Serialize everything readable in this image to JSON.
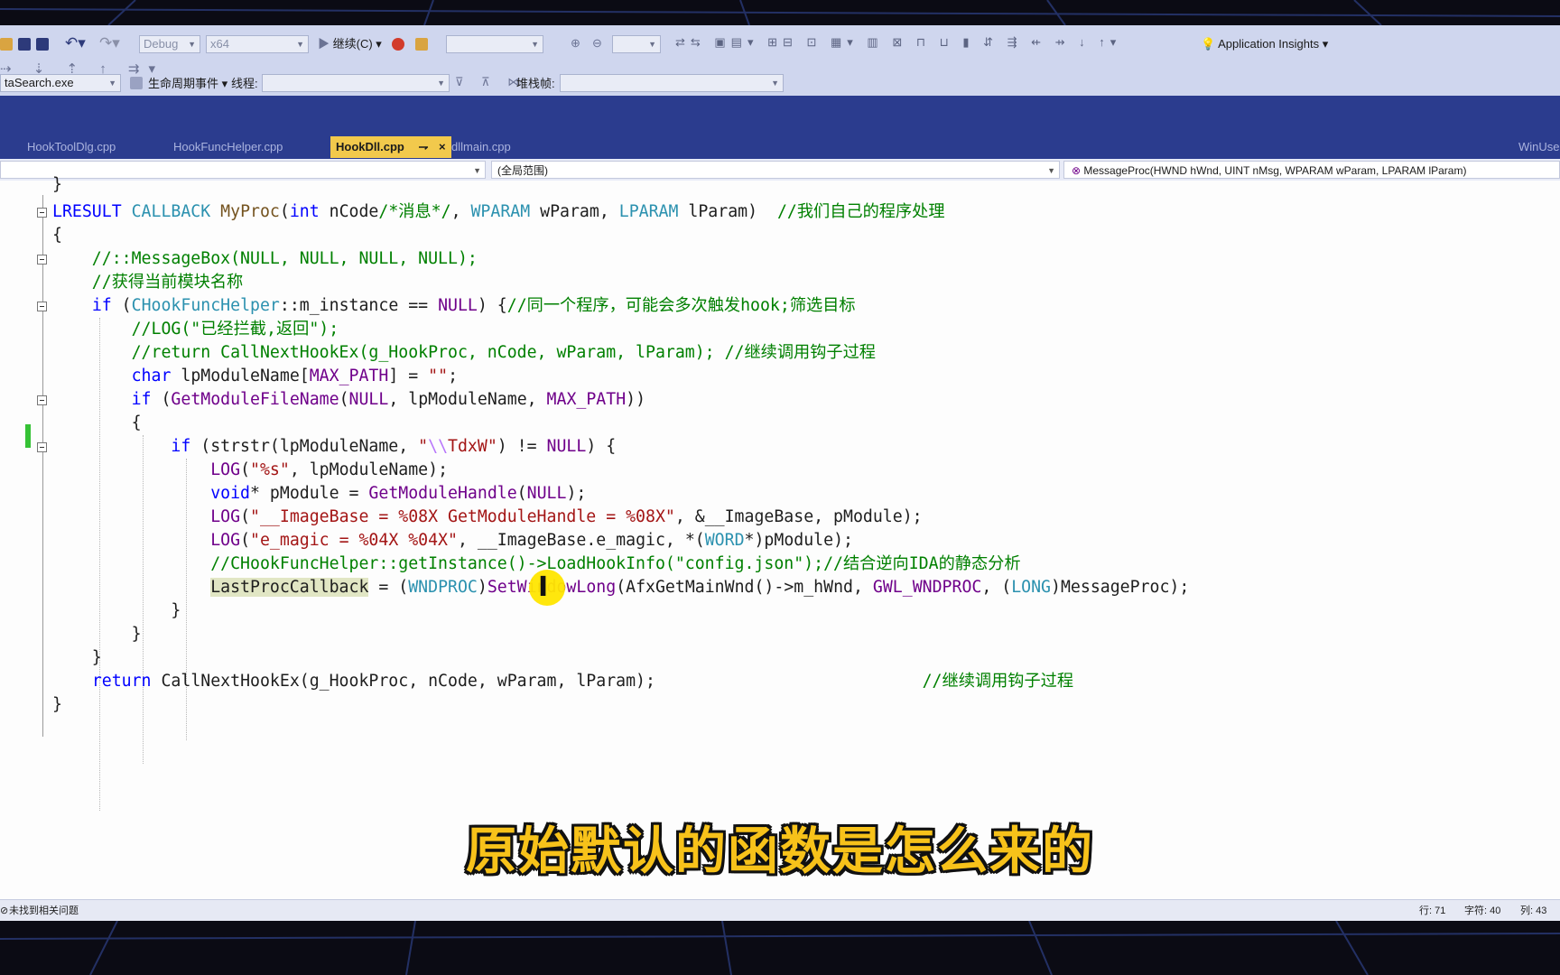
{
  "toolbar": {
    "config_combo": "Debug",
    "platform_combo": "x64",
    "continue_label": "继续(C)",
    "app_insights": "Application Insights"
  },
  "debugbar": {
    "process_combo": "taSearch.exe",
    "lifecycle_label": "生命周期事件",
    "thread_label": "线程:",
    "stackframe_label": "堆栈帧:"
  },
  "tabs": [
    {
      "label": "HookToolDlg.cpp"
    },
    {
      "label": "HookFuncHelper.cpp"
    },
    {
      "label": "HookDll.cpp",
      "pin": "⇁",
      "close": "×"
    },
    {
      "label": "dllmain.cpp"
    }
  ],
  "tabs_right_label": "WinUse",
  "navbar": {
    "scope": "(全局范围)",
    "function": "MessageProc(HWND hWnd, UINT nMsg, WPARAM wParam, LPARAM lParam)"
  },
  "code_lines": [
    "}",
    "LRESULT CALLBACK MyProc(int nCode/*消息*/, WPARAM wParam, LPARAM lParam)  //我们自己的程序处理",
    "{",
    "    //::MessageBox(NULL, NULL, NULL, NULL);",
    "    //获得当前模块名称",
    "    if (CHookFuncHelper::m_instance == NULL) {//同一个程序，可能会多次触发hook;筛选目标",
    "        //LOG(\"已经拦截,返回\");",
    "        //return CallNextHookEx(g_HookProc, nCode, wParam, lParam); //继续调用钩子过程",
    "        char lpModuleName[MAX_PATH] = \"\";",
    "        if (GetModuleFileName(NULL, lpModuleName, MAX_PATH))",
    "        {",
    "            if (strstr(lpModuleName, \"\\\\TdxW\") != NULL) {",
    "                LOG(\"%s\", lpModuleName);",
    "                void* pModule = GetModuleHandle(NULL);",
    "                LOG(\"__ImageBase = %08X GetModuleHandle = %08X\", &__ImageBase, pModule);",
    "                LOG(\"e_magic = %04X %04X\", __ImageBase.e_magic, *(WORD*)pModule);",
    "                //CHookFuncHelper::getInstance()->LoadHookInfo(\"config.json\");//结合逆向IDA的静态分析",
    "                LastProcCallback = (WNDPROC)SetWindowLong(AfxGetMainWnd()->m_hWnd, GWL_WNDPROC, (LONG)MessageProc);",
    "            }",
    "        }",
    "    }",
    "    return CallNextHookEx(g_HookProc, nCode, wParam, lParam);                           //继续调用钩子过程",
    "}"
  ],
  "subtitle": "原始默认的函数是怎么来的",
  "status": {
    "message": "未找到相关问题",
    "line": "行: 71",
    "char": "字符: 40",
    "col": "列: 43"
  },
  "colors": {
    "accent_tab": "#f2c94c",
    "title_band": "#2b3c8e",
    "subtitle": "#f7c21a",
    "cursor_highlight": "#ffe600"
  }
}
